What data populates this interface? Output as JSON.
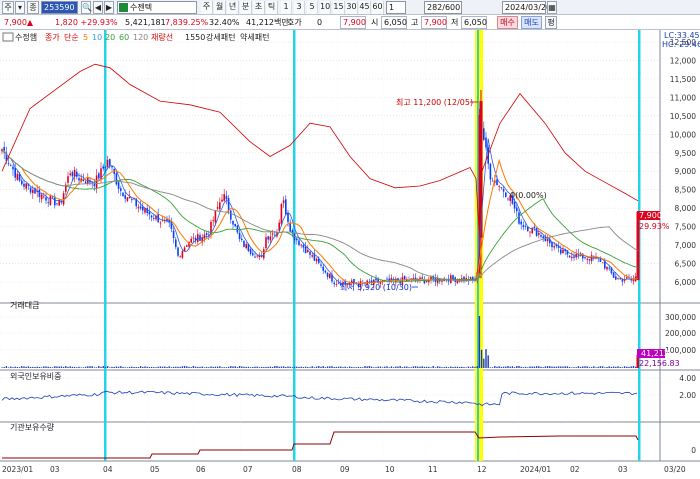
{
  "toolbar": {
    "main_btn": "주",
    "split_btn": "▾",
    "code_type": "종",
    "code": "253590",
    "nav_left": "◀",
    "nav_right": "▶",
    "name": "수젠텍",
    "periods": [
      "주",
      "월",
      "년",
      "분",
      "초",
      "틱"
    ],
    "nums": [
      "1",
      "3",
      "5",
      "10",
      "15",
      "30",
      "45",
      "60"
    ],
    "unit": "1",
    "count": "282/600",
    "date": "2024/03/20",
    "calendar_icon": "calendar-icon",
    "buy": "매수",
    "sell": "매도",
    "extra": "평"
  },
  "quote": {
    "price": "7,900",
    "change": "1,820 +29.93%",
    "volume": "5,421,181",
    "vol_ratio": "7,839.25%",
    "rate": "32.40%",
    "amount": "41,212백만",
    "ask_label": "호가",
    "ask_value": "0",
    "price2": "7,900",
    "open_label": "시",
    "open": "6,050",
    "high_label": "고",
    "high": "7,900",
    "low_label": "저",
    "low": "6,050"
  },
  "panels": {
    "price": {
      "legend": [
        "수정햄",
        "종가",
        "단순",
        "5",
        "10",
        "20",
        "60",
        "120",
        "재량선",
        "1550",
        "강세패턴",
        "약세패턴"
      ],
      "lc_label": "LC:33.45",
      "hc_label": "HC:-29.46",
      "y_ticks": [
        "12,500",
        "12,000",
        "11,500",
        "11,000",
        "10,500",
        "10,000",
        "9,500",
        "9,000",
        "8,500",
        "8,000",
        "7,500",
        "7,000",
        "6,500",
        "6,000"
      ],
      "high_annot": "최고 11,200 (12/05)",
      "low_annot": "최저 5,920 (10/30)",
      "mid_annot": "0(0.00%)",
      "current_price": "7,900",
      "current_pct": "29.93%"
    },
    "volume": {
      "title": "거래대금",
      "y_ticks": [
        "300,000",
        "200,000",
        "100,000"
      ],
      "current": "41,212",
      "current2": "22,156.83"
    },
    "foreign": {
      "title": "외국인보유비중",
      "y_ticks": [
        "4.00",
        "2.00"
      ]
    },
    "inst": {
      "title": "기관보유수량",
      "y_ticks": [
        "0"
      ]
    }
  },
  "x_axis": [
    "2023/01",
    "03",
    "04",
    "05",
    "06",
    "07",
    "08",
    "09",
    "10",
    "11",
    "12",
    "2024/01",
    "02",
    "03",
    "03/20"
  ],
  "colors": {
    "up": "#e0001b",
    "down": "#0a3cff",
    "ma5": "#ff7a00",
    "ma20": "#3aa03a",
    "ma120": "#888888",
    "envelope": "#d40000",
    "vertical_highlight": "#23d4e8",
    "yellow_highlight": "#ffff00"
  }
}
